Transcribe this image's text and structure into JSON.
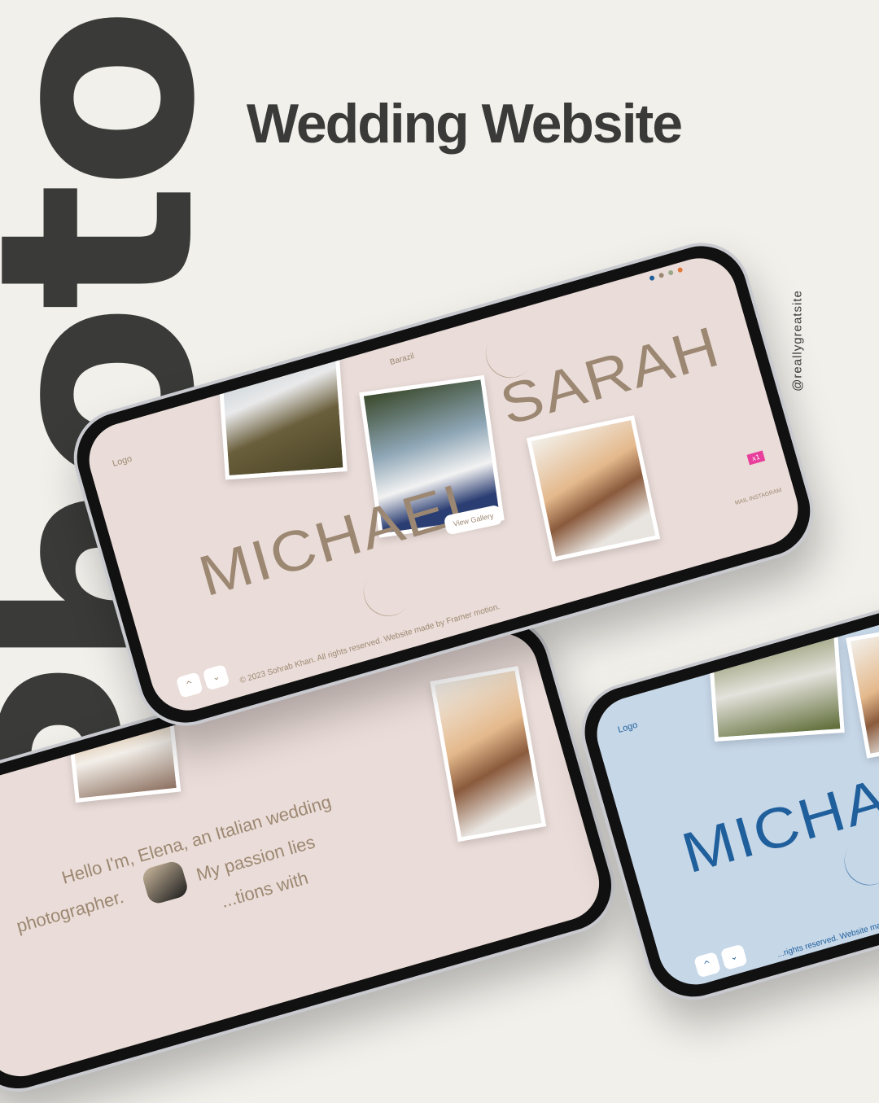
{
  "decor_word": "Photo",
  "title": "Wedding Website",
  "handle": "@reallygreatsite",
  "main_phone": {
    "logo": "Logo",
    "location": "Barazil",
    "name_left": "MICHAEL",
    "name_right": "SARAH",
    "view_gallery": "View Gallery",
    "footer": "© 2023 Sohrab Khan. All rights reserved. Website made by Framer motion.",
    "social": "MAIL INSTAGRAM",
    "badge": "x1",
    "up_icon": "^",
    "down_icon": "⌄",
    "theme_dots": [
      "#1f5f9c",
      "#9c8872",
      "#9aa88c",
      "#e07a3c"
    ]
  },
  "about_phone": {
    "text_line1": "Hello I'm, Elena, an Italian wedding",
    "text_line2": "photographer.",
    "text_line2b": "My passion lies",
    "text_line3": "...tions with"
  },
  "blue_phone": {
    "logo": "Logo",
    "name_left": "MICHAEL",
    "footer": "...rights reserved. Website made by F",
    "up_icon": "^",
    "down_icon": "⌄"
  },
  "colors": {
    "background": "#f1f0eb",
    "pink_theme": "#eadcd8",
    "brown_accent": "#9c8872",
    "blue_theme": "#c6d7e8",
    "blue_accent": "#1f5f9c",
    "badge": "#e83e9c"
  }
}
